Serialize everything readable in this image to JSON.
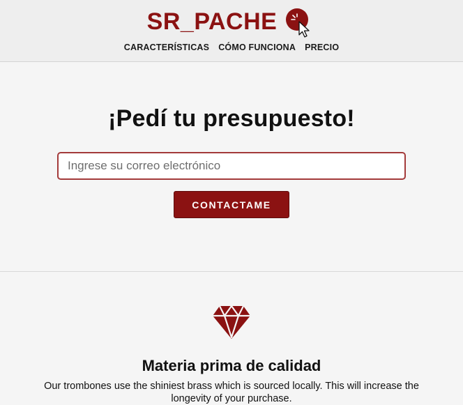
{
  "header": {
    "brand": "SR_PACHE",
    "logo_icon": "cursor-click-icon",
    "nav": [
      {
        "label": "CARACTERÍSTICAS"
      },
      {
        "label": "CÓMO FUNCIONA"
      },
      {
        "label": "PRECIO"
      }
    ]
  },
  "hero": {
    "title": "¡Pedí tu presupuesto!",
    "email_placeholder": "Ingrese su correo electrónico",
    "button_label": "CONTACTAME"
  },
  "feature": {
    "icon": "diamond-icon",
    "title": "Materia prima de calidad",
    "text": "Our trombones use the shiniest brass which is sourced locally. This will increase the longevity of your purchase."
  },
  "colors": {
    "brand": "#8b1212",
    "header_bg": "#eeeeee",
    "page_bg": "#f5f5f5"
  }
}
